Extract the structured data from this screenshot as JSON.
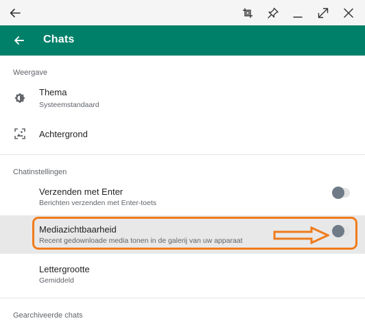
{
  "window": {
    "icons": [
      "back-arrow-icon",
      "screenshot-icon",
      "pin-icon",
      "minimize-icon",
      "expand-icon",
      "close-icon"
    ]
  },
  "appbar": {
    "title": "Chats",
    "color": "#008069"
  },
  "sections": {
    "display": {
      "header": "Weergave",
      "theme": {
        "title": "Thema",
        "subtitle": "Systeemstandaard"
      },
      "wallpaper": {
        "title": "Achtergrond"
      }
    },
    "chat_settings": {
      "header": "Chatinstellingen",
      "enter_send": {
        "title": "Verzenden met Enter",
        "subtitle": "Berichten verzenden met Enter-toets",
        "enabled": false
      },
      "media_visibility": {
        "title": "Mediazichtbaarheid",
        "subtitle": "Recent gedownloade media tonen in de galerij van uw apparaat",
        "enabled": false
      },
      "font_size": {
        "title": "Lettergrootte",
        "subtitle": "Gemiddeld"
      }
    },
    "archived": {
      "header": "Gearchiveerde chats"
    }
  },
  "annotation_color": "#f07b1a"
}
